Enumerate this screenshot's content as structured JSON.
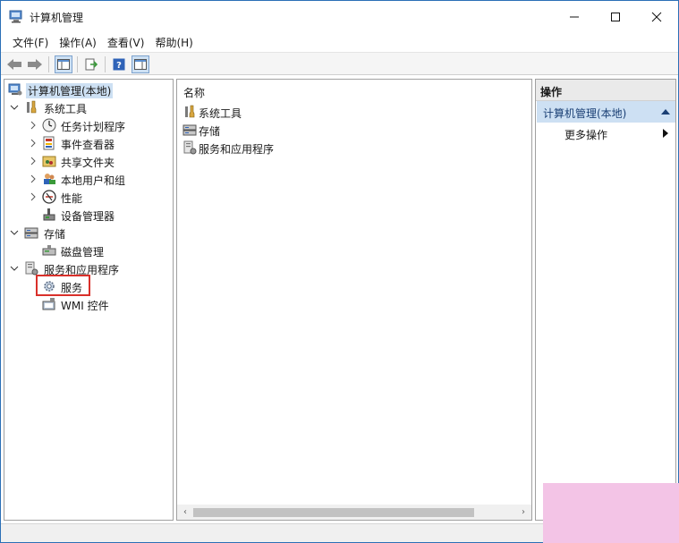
{
  "window": {
    "title": "计算机管理"
  },
  "menu": [
    "文件(F)",
    "操作(A)",
    "查看(V)",
    "帮助(H)"
  ],
  "tree": {
    "root": "计算机管理(本地)",
    "system_tools": "系统工具",
    "task_scheduler": "任务计划程序",
    "event_viewer": "事件查看器",
    "shared_folders": "共享文件夹",
    "local_users": "本地用户和组",
    "performance": "性能",
    "device_manager": "设备管理器",
    "storage": "存储",
    "disk_management": "磁盘管理",
    "services_apps": "服务和应用程序",
    "services": "服务",
    "wmi": "WMI 控件"
  },
  "list": {
    "column_name": "名称",
    "items": [
      "系统工具",
      "存储",
      "服务和应用程序"
    ]
  },
  "actions": {
    "header": "操作",
    "section": "计算机管理(本地)",
    "more": "更多操作"
  },
  "colors": {
    "accent": "#cde0f3",
    "highlight": "#d9302a",
    "border": "#2b6fb6"
  }
}
